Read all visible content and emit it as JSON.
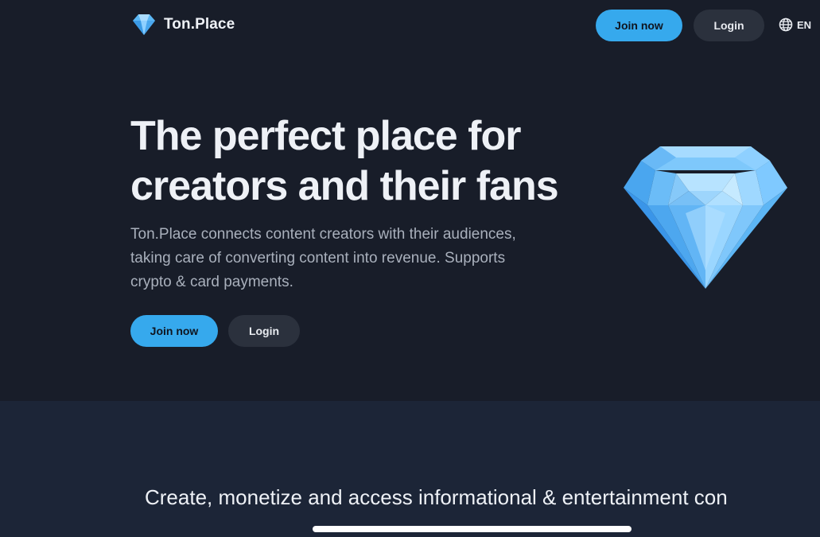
{
  "header": {
    "brand": "Ton.Place",
    "join_label": "Join now",
    "login_label": "Login",
    "language": "EN"
  },
  "hero": {
    "title_line1": "The perfect place for",
    "title_line2": "creators and their fans",
    "subtitle_line1": "Ton.Place connects content creators with their audiences,",
    "subtitle_line2": "taking care of converting content into revenue. Supports",
    "subtitle_line3": "crypto & card payments.",
    "join_label": "Join now",
    "login_label": "Login"
  },
  "section": {
    "heading": "Create, monetize and access informational & entertainment con"
  },
  "icons": {
    "logo": "diamond-icon",
    "language": "globe-icon",
    "hero_art": "diamond-illustration"
  },
  "colors": {
    "accent": "#36a9ed",
    "hero_background": "#181d29",
    "section_background": "#1c2537",
    "secondary_button": "#2b313d"
  }
}
